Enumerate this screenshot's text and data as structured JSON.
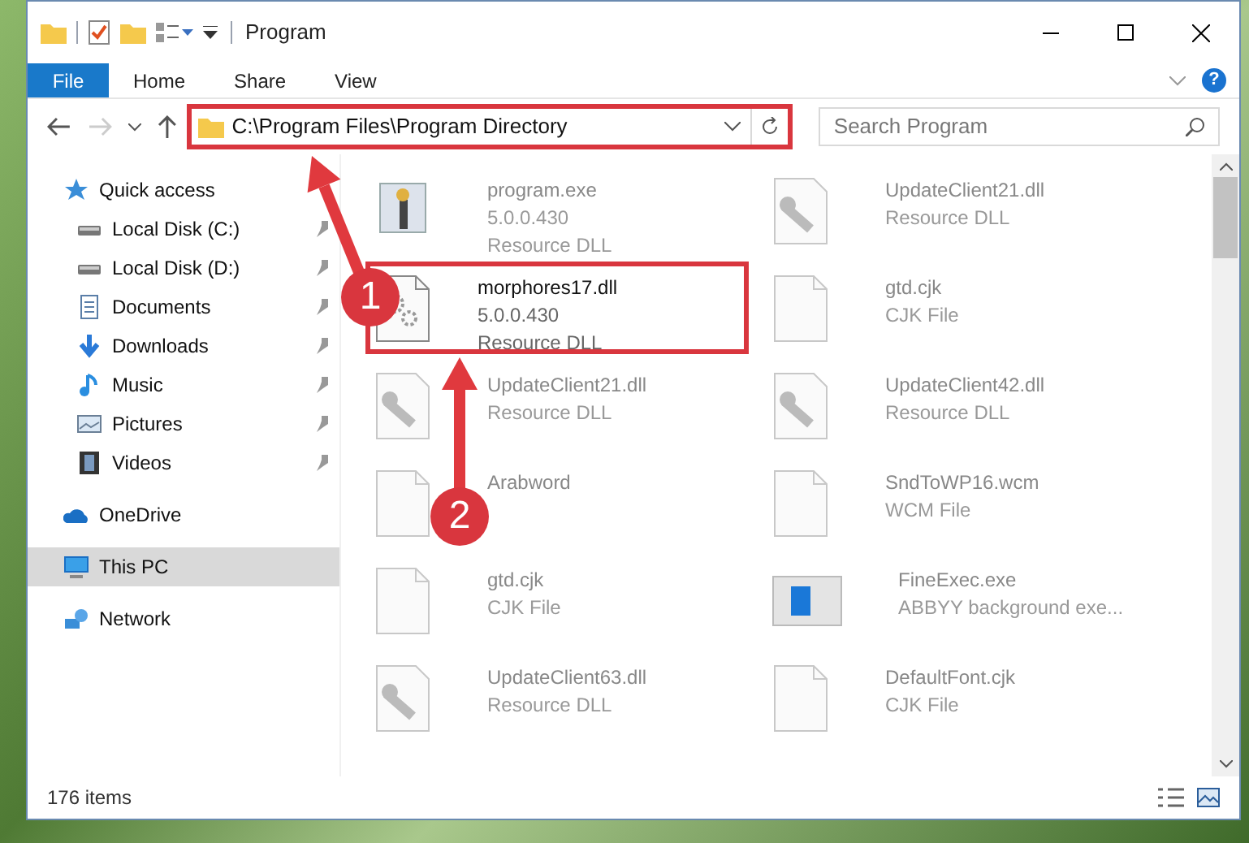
{
  "window": {
    "title": "Program"
  },
  "ribbon_tabs": [
    {
      "label": "File",
      "selected": true
    },
    {
      "label": "Home",
      "selected": false
    },
    {
      "label": "Share",
      "selected": false
    },
    {
      "label": "View",
      "selected": false
    }
  ],
  "address_bar": {
    "path": "C:\\Program Files\\Program Directory"
  },
  "search": {
    "placeholder": "Search Program"
  },
  "help_button": {
    "label": "?"
  },
  "navigation": [
    {
      "label": "Quick access",
      "kind": "star",
      "selected": false,
      "children": [
        {
          "label": "Local Disk (C:)",
          "kind": "disk",
          "pinned": true
        },
        {
          "label": "Local Disk (D:)",
          "kind": "disk",
          "pinned": true
        },
        {
          "label": "Documents",
          "kind": "doc",
          "pinned": true
        },
        {
          "label": "Downloads",
          "kind": "download",
          "pinned": true
        },
        {
          "label": "Music",
          "kind": "music",
          "pinned": true
        },
        {
          "label": "Pictures",
          "kind": "picture",
          "pinned": true
        },
        {
          "label": "Videos",
          "kind": "video",
          "pinned": true
        }
      ]
    },
    {
      "label": "OneDrive",
      "kind": "cloud",
      "selected": false
    },
    {
      "label": "This PC",
      "kind": "pc",
      "selected": true
    },
    {
      "label": "Network",
      "kind": "network",
      "selected": false
    }
  ],
  "files": [
    {
      "name": "program.exe",
      "lines": [
        "5.0.0.430",
        "Resource DLL"
      ],
      "kind": "exe",
      "highlighted": false
    },
    {
      "name": "UpdateClient21.dll",
      "lines": [
        "Resource DLL"
      ],
      "kind": "dll",
      "highlighted": false
    },
    {
      "name": "morphores17.dll",
      "lines": [
        "5.0.0.430",
        "Resource DLL"
      ],
      "kind": "gear",
      "highlighted": true
    },
    {
      "name": "gtd.cjk",
      "lines": [
        "CJK File"
      ],
      "kind": "blank",
      "highlighted": false
    },
    {
      "name": "UpdateClient21.dll",
      "lines": [
        "Resource DLL"
      ],
      "kind": "dll",
      "highlighted": false
    },
    {
      "name": "UpdateClient42.dll",
      "lines": [
        "Resource DLL"
      ],
      "kind": "dll",
      "highlighted": false
    },
    {
      "name": "Arabword",
      "kind": "blank",
      "highlighted": false
    },
    {
      "name": "SndToWP16.wcm",
      "lines": [
        "WCM File"
      ],
      "kind": "blank",
      "highlighted": false
    },
    {
      "name": "gtd.cjk",
      "lines": [
        "CJK File"
      ],
      "kind": "blank",
      "highlighted": false
    },
    {
      "name": "FineExec.exe",
      "lines": [
        "ABBYY background exe..."
      ],
      "kind": "app",
      "highlighted": false
    },
    {
      "name": "UpdateClient63.dll",
      "lines": [
        "Resource DLL"
      ],
      "kind": "dll",
      "highlighted": false
    },
    {
      "name": "DefaultFont.cjk",
      "lines": [
        "CJK File"
      ],
      "kind": "blank",
      "highlighted": false
    }
  ],
  "status_bar": {
    "item_count": "176 items"
  },
  "annotations": {
    "address_highlighted": true,
    "steps": [
      {
        "label": "1"
      },
      {
        "label": "2"
      }
    ]
  }
}
